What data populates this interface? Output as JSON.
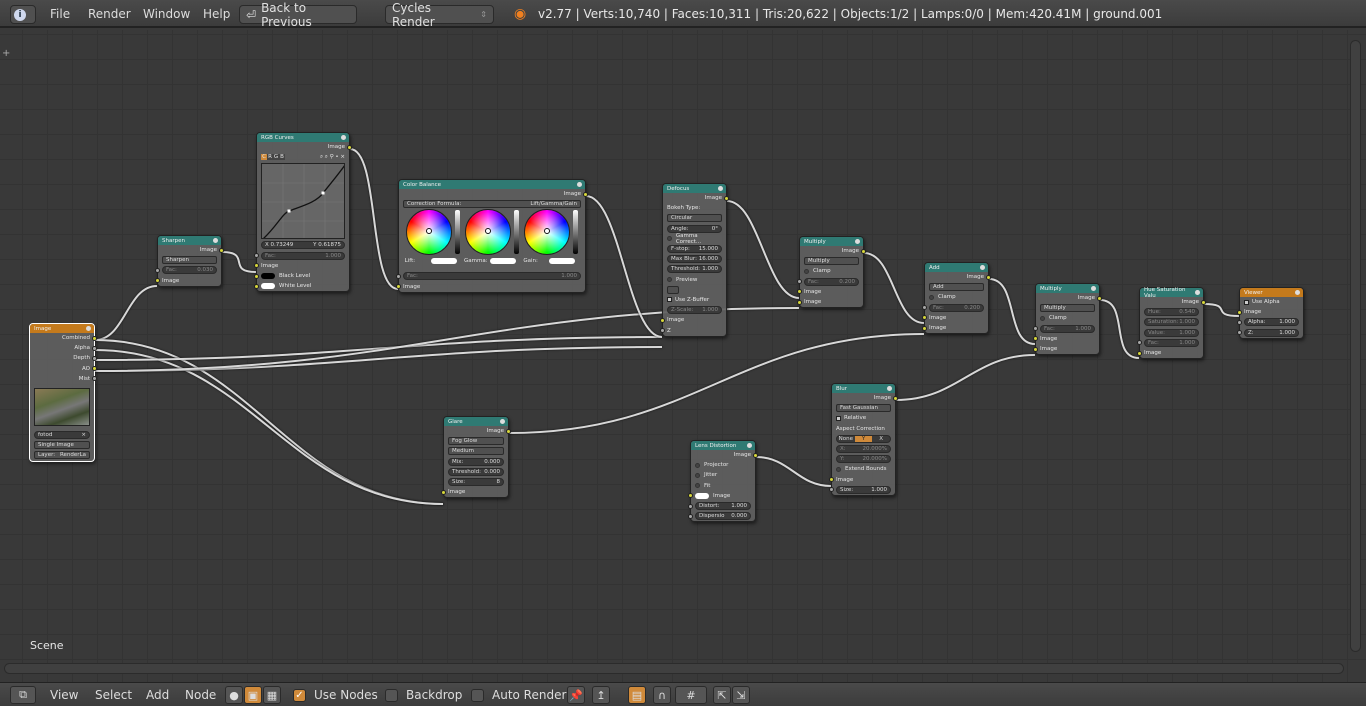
{
  "topbar": {
    "info_icon": "info-icon",
    "menus": [
      "File",
      "Render",
      "Window",
      "Help"
    ],
    "back_button": "Back to Previous",
    "render_engine": "Cycles Render",
    "stats": "v2.77 | Verts:10,740 | Faces:10,311 | Tris:20,622 | Objects:1/2 | Lamps:0/0 | Mem:420.41M | ground.001"
  },
  "editor": {
    "scene_label": "Scene"
  },
  "nodes": [
    {
      "id": "image",
      "title": "Image",
      "header": "orange",
      "selected": true,
      "rows": [
        {
          "t": "out",
          "label": "Combined",
          "s": "y"
        },
        {
          "t": "out",
          "label": "Alpha",
          "s": "g"
        },
        {
          "t": "out",
          "label": "Depth",
          "s": "g"
        },
        {
          "t": "out",
          "label": "AO",
          "s": "y"
        },
        {
          "t": "out",
          "label": "Mist",
          "s": "g"
        },
        {
          "t": "thumb"
        },
        {
          "t": "imgsel",
          "label": "fotod"
        },
        {
          "t": "select",
          "label": "Single Image"
        },
        {
          "t": "select",
          "label": "Layer:",
          "value": "RenderLa"
        }
      ]
    },
    {
      "id": "sharpen",
      "title": "Sharpen",
      "rows": [
        {
          "t": "out",
          "label": "Image",
          "s": "y"
        },
        {
          "t": "select",
          "label": "Sharpen"
        },
        {
          "t": "field",
          "label": "Fac:",
          "value": "0.030",
          "s": "g",
          "dim": true
        },
        {
          "t": "in",
          "label": "Image",
          "s": "y"
        }
      ]
    },
    {
      "id": "rgbcurves",
      "title": "RGB Curves",
      "rows": [
        {
          "t": "out",
          "label": "Image",
          "s": "y"
        },
        {
          "t": "curvetools",
          "channels": [
            "C",
            "R",
            "G",
            "B"
          ]
        },
        {
          "t": "curve"
        },
        {
          "t": "xy",
          "x": "X 0.73249",
          "y": "Y 0.61875"
        },
        {
          "t": "field",
          "label": "Fac:",
          "value": "1.000",
          "s": "g",
          "dim": true
        },
        {
          "t": "in",
          "label": "Image",
          "s": "y"
        },
        {
          "t": "color",
          "label": "Black Level",
          "s": "y",
          "black": true
        },
        {
          "t": "color",
          "label": "White Level",
          "s": "y"
        }
      ]
    },
    {
      "id": "colorbalance",
      "title": "Color Balance",
      "rows": [
        {
          "t": "out",
          "label": "Image",
          "s": "y"
        },
        {
          "t": "field",
          "label": "Correction Formula:",
          "value": "Lift/Gamma/Gain",
          "sel": true
        },
        {
          "t": "wheels",
          "labels": [
            "Lift:",
            "Gamma:",
            "Gain:"
          ]
        },
        {
          "t": "field",
          "label": "Fac:",
          "value": "1.000",
          "s": "g",
          "dim": true
        },
        {
          "t": "in",
          "label": "Image",
          "s": "y"
        }
      ]
    },
    {
      "id": "defocus",
      "title": "Defocus",
      "rows": [
        {
          "t": "out",
          "label": "Image",
          "s": "y"
        },
        {
          "t": "text",
          "label": "Bokeh Type:"
        },
        {
          "t": "select",
          "label": "Circular"
        },
        {
          "t": "field",
          "label": "Angle:",
          "value": "0°"
        },
        {
          "t": "radio",
          "label": "Gamma Correct..."
        },
        {
          "t": "field",
          "label": "F-stop:",
          "value": "15.000"
        },
        {
          "t": "field",
          "label": "Max Blur:",
          "value": "16.000"
        },
        {
          "t": "field",
          "label": "Threshold:",
          "value": "1.000"
        },
        {
          "t": "radio",
          "label": "Preview"
        },
        {
          "t": "scenebtn"
        },
        {
          "t": "check",
          "label": "Use Z-Buffer",
          "on": true
        },
        {
          "t": "field",
          "label": "Z-Scale:",
          "value": "1.000",
          "dim": true
        },
        {
          "t": "in",
          "label": "Image",
          "s": "y"
        },
        {
          "t": "in",
          "label": "Z",
          "s": "g"
        }
      ]
    },
    {
      "id": "multiply1",
      "title": "Multiply",
      "rows": [
        {
          "t": "out",
          "label": "Image",
          "s": "y"
        },
        {
          "t": "select",
          "label": "Multiply"
        },
        {
          "t": "radio",
          "label": "Clamp"
        },
        {
          "t": "field",
          "label": "Fac:",
          "value": "0.200",
          "s": "g",
          "dim": true
        },
        {
          "t": "in",
          "label": "Image",
          "s": "y"
        },
        {
          "t": "in",
          "label": "Image",
          "s": "y"
        }
      ]
    },
    {
      "id": "add",
      "title": "Add",
      "rows": [
        {
          "t": "out",
          "label": "Image",
          "s": "y"
        },
        {
          "t": "select",
          "label": "Add"
        },
        {
          "t": "radio",
          "label": "Clamp"
        },
        {
          "t": "field",
          "label": "Fac:",
          "value": "0.200",
          "s": "g",
          "dim": true
        },
        {
          "t": "in",
          "label": "Image",
          "s": "y"
        },
        {
          "t": "in",
          "label": "Image",
          "s": "y"
        }
      ]
    },
    {
      "id": "multiply2",
      "title": "Multiply",
      "rows": [
        {
          "t": "out",
          "label": "Image",
          "s": "y"
        },
        {
          "t": "select",
          "label": "Multiply"
        },
        {
          "t": "radio",
          "label": "Clamp"
        },
        {
          "t": "field",
          "label": "Fac:",
          "value": "1.000",
          "s": "g",
          "dim": true
        },
        {
          "t": "in",
          "label": "Image",
          "s": "y"
        },
        {
          "t": "in",
          "label": "Image",
          "s": "y"
        }
      ]
    },
    {
      "id": "huesat",
      "title": "Hue Saturation Valu",
      "rows": [
        {
          "t": "out",
          "label": "Image",
          "s": "y"
        },
        {
          "t": "field",
          "label": "Hue:",
          "value": "0.540",
          "dim": true
        },
        {
          "t": "field",
          "label": "Saturation:",
          "value": "1.000",
          "dim": true
        },
        {
          "t": "field",
          "label": "Value:",
          "value": "1.000",
          "dim": true
        },
        {
          "t": "field",
          "label": "Fac:",
          "value": "1.000",
          "s": "g",
          "dim": true
        },
        {
          "t": "in",
          "label": "Image",
          "s": "y"
        }
      ]
    },
    {
      "id": "viewer",
      "title": "Viewer",
      "header": "orange",
      "rows": [
        {
          "t": "check",
          "label": "Use Alpha",
          "on": true
        },
        {
          "t": "in",
          "label": "Image",
          "s": "y"
        },
        {
          "t": "field",
          "label": "Alpha:",
          "value": "1.000",
          "s": "g"
        },
        {
          "t": "field",
          "label": "Z:",
          "value": "1.000",
          "s": "g"
        }
      ]
    },
    {
      "id": "glare",
      "title": "Glare",
      "rows": [
        {
          "t": "out",
          "label": "Image",
          "s": "y"
        },
        {
          "t": "select",
          "label": "Fog Glow"
        },
        {
          "t": "select",
          "label": "Medium"
        },
        {
          "t": "field",
          "label": "Mix:",
          "value": "0.000"
        },
        {
          "t": "field",
          "label": "Threshold:",
          "value": "0.000"
        },
        {
          "t": "field",
          "label": "Size:",
          "value": "8"
        },
        {
          "t": "in",
          "label": "Image",
          "s": "y"
        }
      ]
    },
    {
      "id": "lens",
      "title": "Lens Distortion",
      "rows": [
        {
          "t": "out",
          "label": "Image",
          "s": "y"
        },
        {
          "t": "radio",
          "label": "Projector"
        },
        {
          "t": "radio",
          "label": "Jitter"
        },
        {
          "t": "radio",
          "label": "Fit"
        },
        {
          "t": "color",
          "label": "Image",
          "s": "y"
        },
        {
          "t": "field",
          "label": "Distort:",
          "value": "1.000",
          "s": "g"
        },
        {
          "t": "field",
          "label": "Dispersio",
          "value": "0.000",
          "s": "g"
        }
      ]
    },
    {
      "id": "blur",
      "title": "Blur",
      "rows": [
        {
          "t": "out",
          "label": "Image",
          "s": "y"
        },
        {
          "t": "select",
          "label": "Fast Gaussian"
        },
        {
          "t": "check",
          "label": "Relative",
          "on": true
        },
        {
          "t": "text",
          "label": "Aspect Correction"
        },
        {
          "t": "seg",
          "options": [
            "None",
            "Y",
            "X"
          ],
          "active": 1
        },
        {
          "t": "field",
          "label": "X:",
          "value": "20.000%",
          "dim": true
        },
        {
          "t": "field",
          "label": "Y:",
          "value": "20.000%",
          "dim": true
        },
        {
          "t": "radio",
          "label": "Extend Bounds"
        },
        {
          "t": "in",
          "label": "Image",
          "s": "y"
        },
        {
          "t": "field",
          "label": "Size:",
          "value": "1.000",
          "s": "g"
        }
      ]
    }
  ],
  "bottombar": {
    "menus": [
      "View",
      "Select",
      "Add",
      "Node"
    ],
    "use_nodes": {
      "label": "Use Nodes",
      "checked": true
    },
    "backdrop": {
      "label": "Backdrop",
      "checked": false
    },
    "auto_render": {
      "label": "Auto Render",
      "checked": false
    }
  }
}
